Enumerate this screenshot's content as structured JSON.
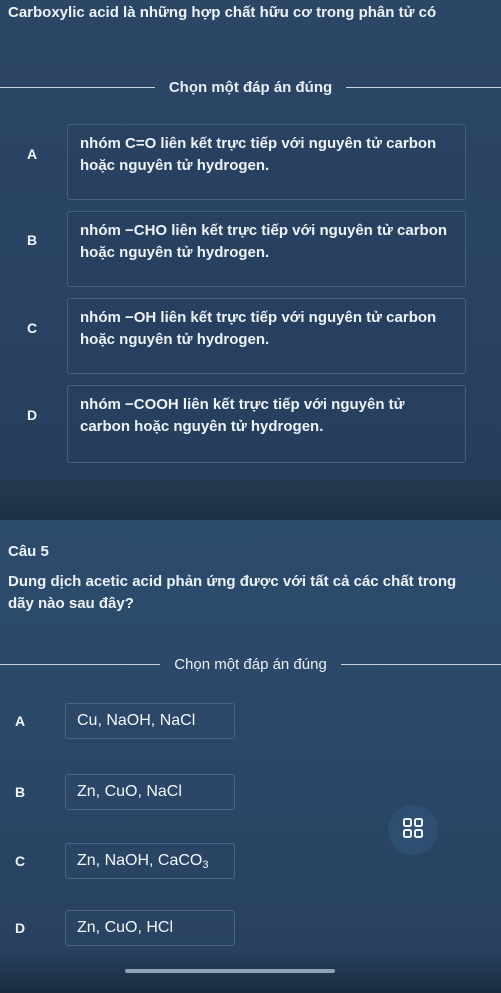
{
  "question4": {
    "text": "Carboxylic acid là những hợp chất hữu cơ trong phân tử có",
    "prompt": "Chọn một đáp án đúng",
    "options": [
      {
        "letter": "A",
        "text": "nhóm C=O liên kết trực tiếp với nguyên tử carbon hoặc nguyên tử hydrogen."
      },
      {
        "letter": "B",
        "text": "nhóm −CHO liên kết trực tiếp với nguyên tử carbon hoặc nguyên tử hydrogen."
      },
      {
        "letter": "C",
        "text": "nhóm −OH liên kết trực tiếp với nguyên tử carbon hoặc nguyên tử hydrogen."
      },
      {
        "letter": "D",
        "text": "nhóm −COOH liên kết trực tiếp với nguyên tử carbon hoặc nguyên tử hydrogen."
      }
    ]
  },
  "question5": {
    "number": "Câu 5",
    "text": "Dung dịch acetic acid phản ứng được với tất cả các chất trong dãy nào sau đây?",
    "prompt": "Chọn một đáp án đúng",
    "options": [
      {
        "letter": "A",
        "text": "Cu, NaOH, NaCl"
      },
      {
        "letter": "B",
        "text": "Zn, CuO, NaCl"
      },
      {
        "letter": "C",
        "text_main": "Zn, NaOH, CaCO",
        "text_sub": "3"
      },
      {
        "letter": "D",
        "text": "Zn, CuO, HCl"
      }
    ]
  },
  "fab_icon": "grid-icon"
}
